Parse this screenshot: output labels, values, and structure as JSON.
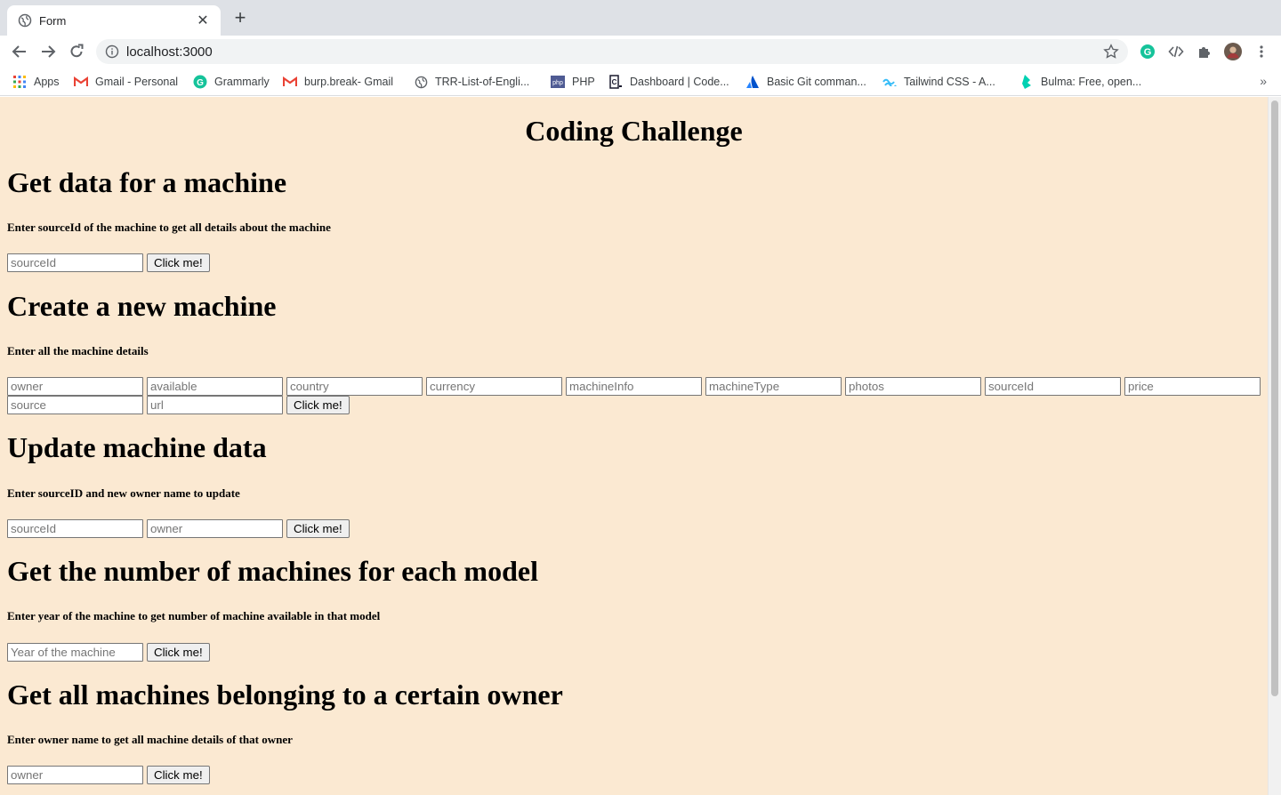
{
  "browser": {
    "tab_title": "Form",
    "tab_close": "✕",
    "new_tab": "+",
    "url": "localhost:3000",
    "bookmarks": [
      {
        "label": "Apps",
        "icon": "apps-grid-icon"
      },
      {
        "label": "Gmail - Personal",
        "icon": "gmail-icon"
      },
      {
        "label": "Grammarly",
        "icon": "grammarly-icon"
      },
      {
        "label": "burp.break- Gmail",
        "icon": "gmail-icon"
      },
      {
        "label": "TRR-List-of-Engli...",
        "icon": "globe-icon"
      },
      {
        "label": "PHP",
        "icon": "php-icon"
      },
      {
        "label": "Dashboard | Code...",
        "icon": "code-icon"
      },
      {
        "label": "Basic Git comman...",
        "icon": "atlassian-icon"
      },
      {
        "label": "Tailwind CSS - A...",
        "icon": "tailwind-icon"
      },
      {
        "label": "Bulma: Free, open...",
        "icon": "bulma-icon"
      }
    ],
    "bookmarks_more": "»"
  },
  "page": {
    "title": "Coding Challenge",
    "background": "#fbe9d2",
    "sections": [
      {
        "heading": "Get data for a machine",
        "description": "Enter sourceId of the machine to get all details about the machine",
        "inputs": [
          "sourceId"
        ],
        "button": "Click me!"
      },
      {
        "heading": "Create a new machine",
        "description": "Enter all the machine details",
        "inputs": [
          "owner",
          "available",
          "country",
          "currency",
          "machineInfo",
          "machineType",
          "photos",
          "sourceId",
          "price",
          "source",
          "url"
        ],
        "button": "Click me!"
      },
      {
        "heading": "Update machine data",
        "description": "Enter sourceID and new owner name to update",
        "inputs": [
          "sourceId",
          "owner"
        ],
        "button": "Click me!"
      },
      {
        "heading": "Get the number of machines for each model",
        "description": "Enter year of the machine to get number of machine available in that model",
        "inputs": [
          "Year of the machine"
        ],
        "button": "Click me!"
      },
      {
        "heading": "Get all machines belonging to a certain owner",
        "description": "Enter owner name to get all machine details of that owner",
        "inputs": [
          "owner"
        ],
        "button": "Click me!"
      }
    ]
  }
}
